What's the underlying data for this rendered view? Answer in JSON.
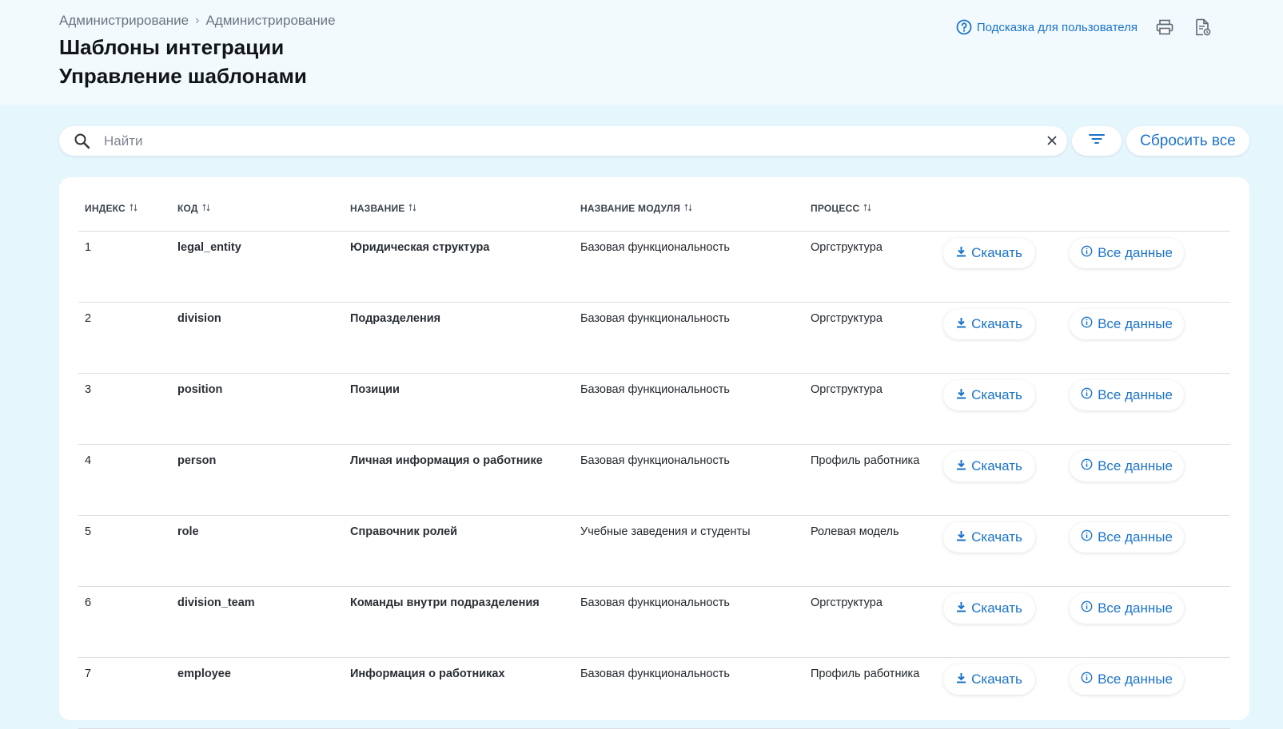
{
  "breadcrumb": [
    "Администрирование",
    "Администрирование"
  ],
  "page": {
    "title": "Шаблоны интеграции",
    "subtitle": "Управление шаблонами"
  },
  "header": {
    "help_label": "Подсказка для пользователя"
  },
  "search": {
    "placeholder": "Найти",
    "value": ""
  },
  "toolbar": {
    "reset_label": "Сбросить все"
  },
  "table": {
    "columns": [
      "ИНДЕКС",
      "КОД",
      "НАЗВАНИЕ",
      "НАЗВАНИЕ МОДУЛЯ",
      "ПРОЦЕСС"
    ],
    "download_label": "Скачать",
    "details_label": "Все данные",
    "rows": [
      {
        "index": "1",
        "code": "legal_entity",
        "name": "Юридическая структура",
        "module": "Базовая функциональность",
        "process": "Оргструктура"
      },
      {
        "index": "2",
        "code": "division",
        "name": "Подразделения",
        "module": "Базовая функциональность",
        "process": "Оргструктура"
      },
      {
        "index": "3",
        "code": "position",
        "name": "Позиции",
        "module": "Базовая функциональность",
        "process": "Оргструктура"
      },
      {
        "index": "4",
        "code": "person",
        "name": "Личная информация о работнике",
        "module": "Базовая функциональность",
        "process": "Профиль работника"
      },
      {
        "index": "5",
        "code": "role",
        "name": "Справочник ролей",
        "module": "Учебные заведения и студенты",
        "process": "Ролевая модель"
      },
      {
        "index": "6",
        "code": "division_team",
        "name": "Команды внутри подразделения",
        "module": "Базовая функциональность",
        "process": "Оргструктура"
      },
      {
        "index": "7",
        "code": "employee",
        "name": "Информация о работниках",
        "module": "Базовая функциональность",
        "process": "Профиль работника"
      }
    ]
  },
  "icons": {
    "help": "question-circle-icon",
    "print": "printer-icon",
    "export": "document-export-icon",
    "search": "magnifier-icon",
    "clear": "close-icon",
    "filter": "filter-lines-icon",
    "download": "download-arrow-icon",
    "details": "info-circle-icon",
    "sort": "sort-icon"
  },
  "colors": {
    "accent": "#1a73c9",
    "page_bg": "#e6f6fd",
    "header_bg": "#f3fafe"
  }
}
